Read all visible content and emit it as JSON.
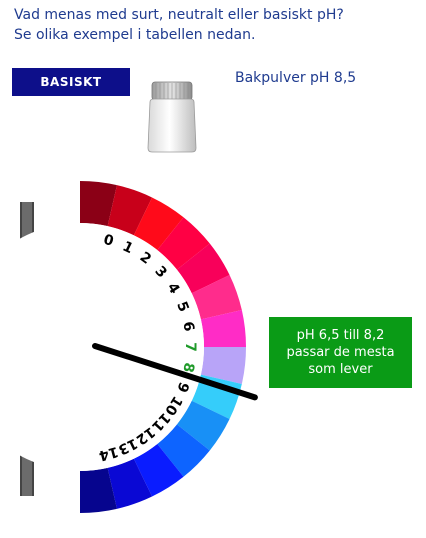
{
  "question": {
    "line1": "Vad menas med surt, neutralt eller basiskt pH?",
    "line2": "Se olika exempel i tabellen nedan."
  },
  "category_button": {
    "label": "BASISKT"
  },
  "item": {
    "label": "Bakpulver pH 8,5",
    "icon": "jar-icon"
  },
  "dial": {
    "ph_scale": [
      "0",
      "1",
      "2",
      "3",
      "4",
      "5",
      "6",
      "7",
      "8",
      "9",
      "10",
      "11",
      "12",
      "13",
      "14"
    ],
    "highlight_range": [
      "7",
      "8"
    ],
    "highlight_color": "#1f9a2a",
    "segment_colors": [
      "#8b0016",
      "#c8001a",
      "#ff0a1a",
      "#ff0044",
      "#f8005a",
      "#ff2c8c",
      "#ff2cc6",
      "#b8a4f8",
      "#35cdfa",
      "#1890f6",
      "#0d64ff",
      "#0a1cff",
      "#0a08d4",
      "#06058e"
    ],
    "indicator_value": 8.5
  },
  "info_box": {
    "text": "pH 6,5 till 8,2 passar de mesta som lever",
    "color": "#0a9b16"
  }
}
